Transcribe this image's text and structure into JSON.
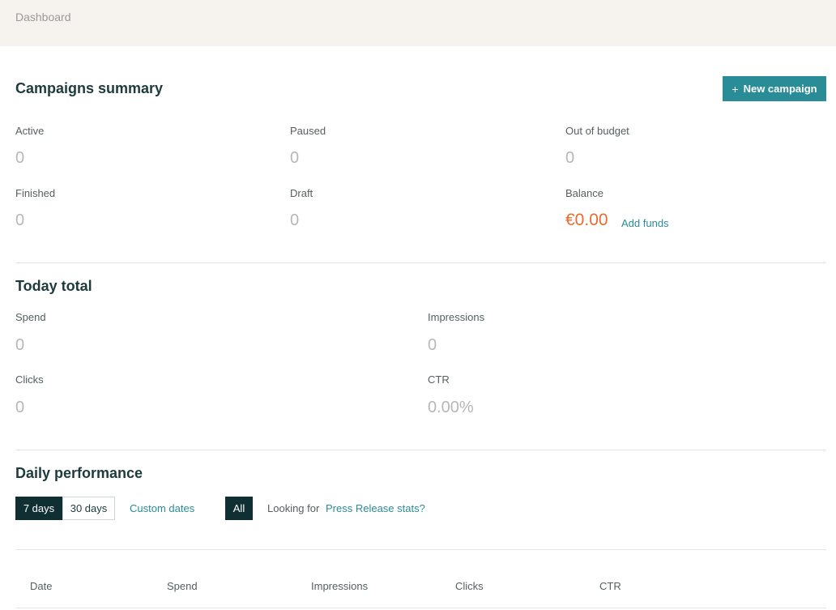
{
  "header": {
    "breadcrumb": "Dashboard"
  },
  "campaigns_summary": {
    "title": "Campaigns summary",
    "new_campaign_label": "New campaign",
    "stats": [
      {
        "label": "Active",
        "value": "0"
      },
      {
        "label": "Paused",
        "value": "0"
      },
      {
        "label": "Out of budget",
        "value": "0"
      },
      {
        "label": "Finished",
        "value": "0"
      },
      {
        "label": "Draft",
        "value": "0"
      }
    ],
    "balance_label": "Balance",
    "balance_value": "€0.00",
    "add_funds_label": "Add funds"
  },
  "today_total": {
    "title": "Today total",
    "stats": [
      {
        "label": "Spend",
        "value": "0"
      },
      {
        "label": "Impressions",
        "value": "0"
      },
      {
        "label": "Clicks",
        "value": "0"
      },
      {
        "label": "CTR",
        "value": "0.00%"
      }
    ]
  },
  "daily_performance": {
    "title": "Daily performance",
    "range_buttons": [
      {
        "label": "7 days",
        "active": true
      },
      {
        "label": "30 days",
        "active": false
      }
    ],
    "custom_dates_label": "Custom dates",
    "filter_all_label": "All",
    "press_release_prefix": "Looking for",
    "press_release_link": "Press Release stats?",
    "table_headers": [
      "Date",
      "Spend",
      "Impressions",
      "Clicks",
      "CTR"
    ]
  },
  "colors": {
    "accent": "#2a8c96",
    "balance": "#ea6b2f",
    "dark": "#0f2f33",
    "topbar": "#f6f3ef"
  }
}
